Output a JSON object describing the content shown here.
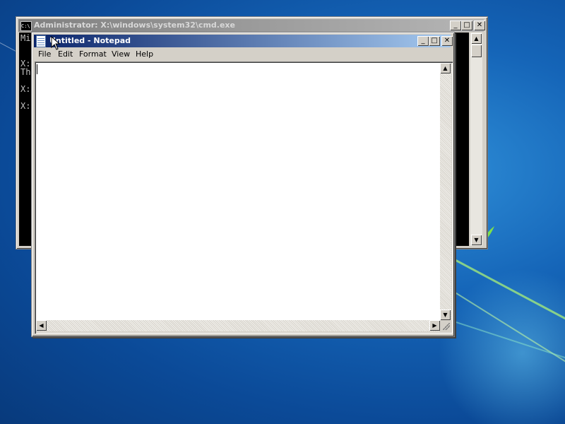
{
  "cmd_window": {
    "title": "Administrator: X:\\windows\\system32\\cmd.exe",
    "icon_label": "C:\\",
    "console_lines": [
      "Mi",
      "",
      "X:",
      "Th",
      "",
      "X:",
      "",
      "X:"
    ],
    "controls": {
      "minimize": "_",
      "maximize": "□",
      "close": "✕"
    }
  },
  "notepad_window": {
    "title": "Untitled - Notepad",
    "menu": [
      "File",
      "Edit",
      "Format",
      "View",
      "Help"
    ],
    "content": "",
    "controls": {
      "minimize": "_",
      "maximize": "□",
      "close": "✕"
    }
  },
  "scroll_arrows": {
    "up": "▲",
    "down": "▼",
    "left": "◀",
    "right": "▶"
  },
  "icons": [
    "cmd-app-icon",
    "notepad-app-icon",
    "mouse-pointer-icon",
    "windows-logo-icon"
  ],
  "colors": {
    "notepad_title_start": "#0a246a",
    "notepad_title_end": "#a6caf0",
    "cmd_title_inactive": "#808080",
    "desktop": "#1565b8"
  }
}
